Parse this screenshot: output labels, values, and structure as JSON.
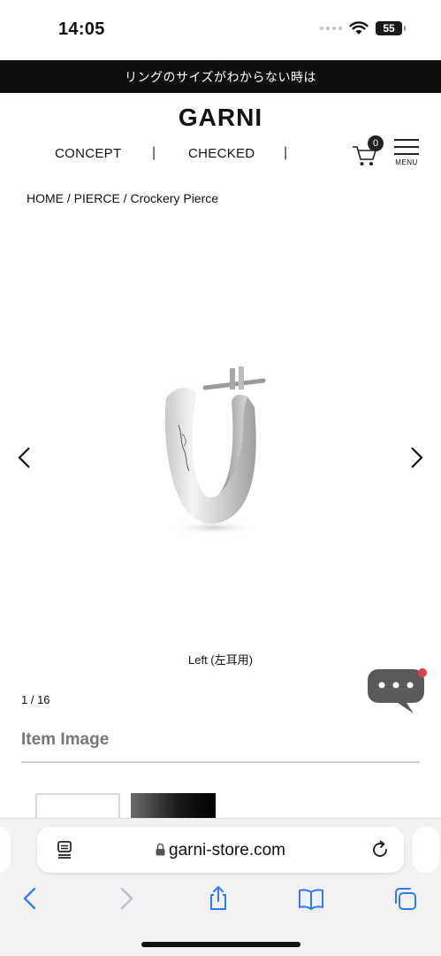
{
  "status_bar": {
    "time": "14:05",
    "battery": "55"
  },
  "banner": {
    "text": "リングのサイズがわからない時は"
  },
  "header": {
    "logo": "GARNI",
    "nav": [
      {
        "label": "CONCEPT"
      },
      {
        "label": "CHECKED"
      }
    ],
    "separator": "|",
    "cart_count": "0",
    "menu_label": "MENU"
  },
  "breadcrumb": {
    "text": "HOME / PIERCE / Crockery Pierce"
  },
  "product": {
    "image_icon": "silver-hoop-earring",
    "caption": "Left (左耳用)",
    "counter": "1 / 16"
  },
  "chat": {
    "icon": "chat-bubble-icon",
    "color": "#5a5a5a",
    "notification_color": "#e53b4a"
  },
  "item_image": {
    "heading": "Item Image"
  },
  "browser": {
    "url": "garni-store.com",
    "accent": "#2f7cf6"
  }
}
